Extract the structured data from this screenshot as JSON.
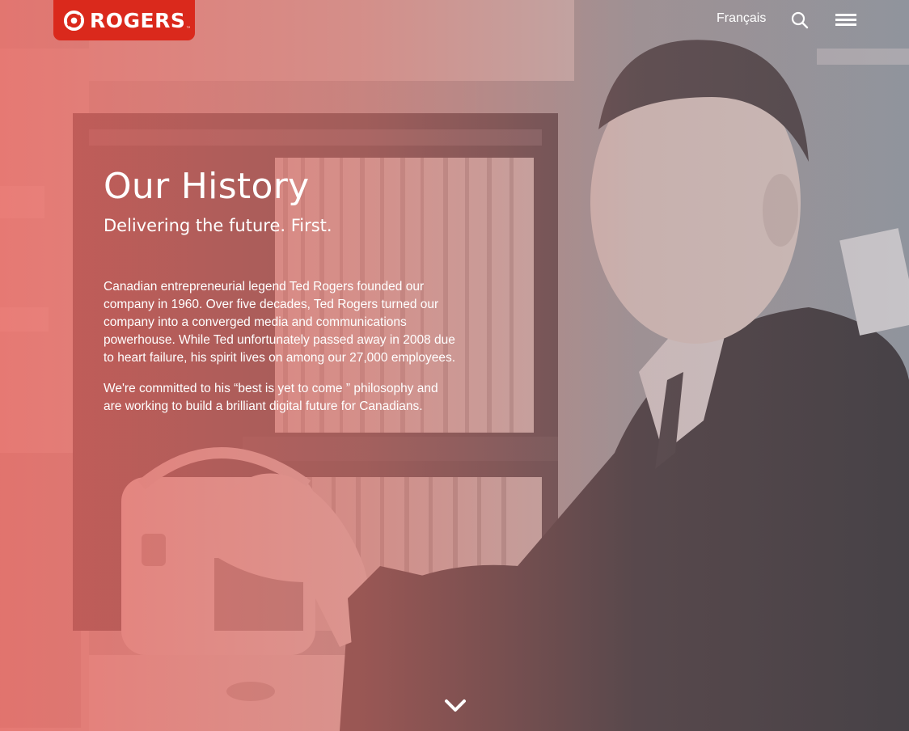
{
  "brand": {
    "name": "ROGERS",
    "trademark": "™",
    "color": "#da291c"
  },
  "header": {
    "language_link": "Français",
    "search_icon": "search-icon",
    "menu_icon": "hamburger-menu-icon"
  },
  "hero": {
    "title": "Our History",
    "subtitle": "Delivering the future. First.",
    "paragraphs": [
      "Canadian entrepreneurial legend Ted Rogers founded our company in 1960. Over five decades, Ted Rogers turned our company into a converged media and communications powerhouse. While Ted unfortunately passed away in 2008 due to heart failure, his spirit lives on among our 27,000 employees.",
      "We're committed to his “best is yet to come ” philosophy and are working to build a brilliant digital future for Canadians."
    ],
    "scroll_icon": "chevron-down-icon",
    "overlay_color": "#ee6862"
  }
}
